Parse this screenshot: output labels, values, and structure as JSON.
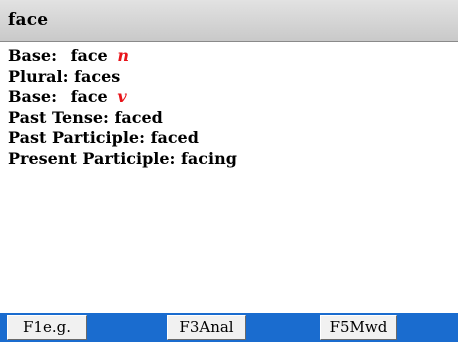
{
  "header": {
    "title": "face"
  },
  "entries": [
    {
      "label": "Base:",
      "value": "face",
      "pos": "n"
    },
    {
      "label": "Plural:",
      "value": "faces"
    },
    {
      "label": "Base:",
      "value": "face",
      "pos": "v"
    },
    {
      "label": "Past Tense:",
      "value": "faced"
    },
    {
      "label": "Past Participle:",
      "value": "faced"
    },
    {
      "label": "Present Participle:",
      "value": "facing"
    }
  ],
  "softkeys": [
    {
      "label": "F1e.g."
    },
    {
      "label": "F3Anal"
    },
    {
      "label": "F5Mwd"
    }
  ],
  "colors": {
    "header_bg": "#d4d4d4",
    "softkey_bar": "#1a6ccf",
    "part_of_speech": "#e8141a"
  }
}
